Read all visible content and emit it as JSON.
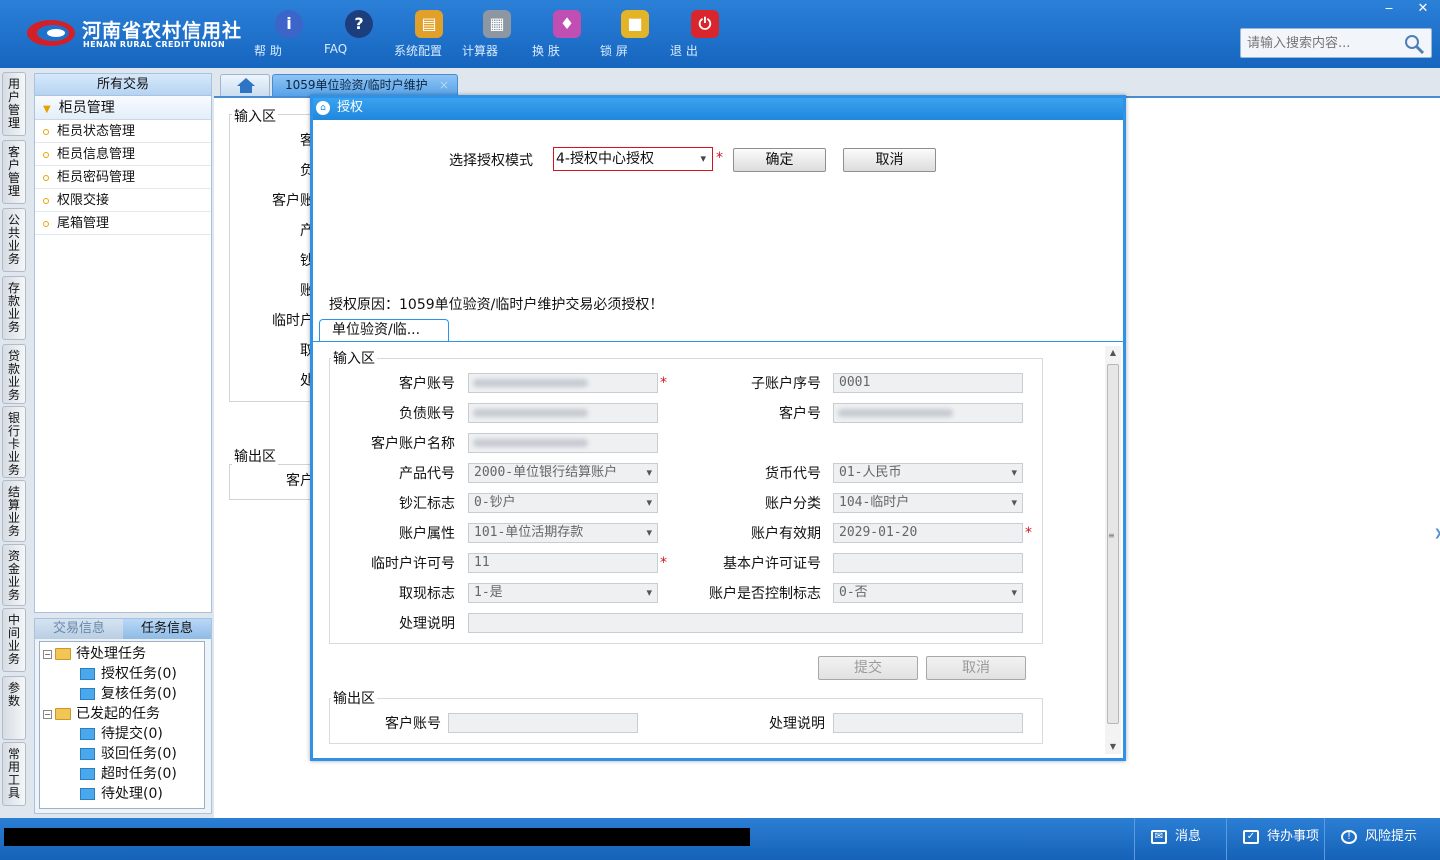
{
  "header": {
    "logo_cn": "河南省农村信用社",
    "logo_en": "HENAN RURAL CREDIT UNION",
    "tools": [
      {
        "label": "帮 助",
        "icon": "info-icon"
      },
      {
        "label": "FAQ",
        "icon": "question-icon"
      },
      {
        "label": "系统配置",
        "icon": "toolbox-icon"
      },
      {
        "label": "计算器",
        "icon": "calculator-icon"
      },
      {
        "label": "换 肤",
        "icon": "shirt-icon"
      },
      {
        "label": "锁 屏",
        "icon": "lock-icon"
      },
      {
        "label": "退 出",
        "icon": "power-icon"
      }
    ],
    "search_placeholder": "请输入搜索内容..."
  },
  "vtabs": [
    "用户管理",
    "客户管理",
    "公共业务",
    "存款业务",
    "贷款业务",
    "银行卡业务",
    "结算业务",
    "资金业务",
    "中间业务",
    "参数",
    "常用工具"
  ],
  "nav": {
    "head": "所有交易",
    "group": "柜员管理",
    "items": [
      "柜员状态管理",
      "柜员信息管理",
      "柜员密码管理",
      "权限交接",
      "尾箱管理"
    ]
  },
  "taskpanel": {
    "tabs": [
      "交易信息",
      "任务信息"
    ],
    "tree": {
      "pending": "待处理任务",
      "pending_children": [
        "授权任务(0)",
        "复核任务(0)"
      ],
      "initiated": "已发起的任务",
      "initiated_children": [
        "待提交(0)",
        "驳回任务(0)",
        "超时任务(0)",
        "待处理(0)"
      ]
    }
  },
  "maintab": {
    "title": "1059单位验资/临时户维护",
    "close": "×"
  },
  "background": {
    "input_legend": "输入区",
    "output_legend": "输出区",
    "labels": [
      "客",
      "负",
      "客户账",
      "产",
      "钞",
      "账",
      "临时户",
      "取",
      "处"
    ],
    "output_label": "客户"
  },
  "dialog": {
    "title": "授权",
    "mode_label": "选择授权模式",
    "mode_value": "4-授权中心授权",
    "confirm": "确定",
    "cancel": "取消",
    "reason": "授权原因：1059单位验资/临时户维护交易必须授权！",
    "subtab": "单位验资/临...",
    "input_legend": "输入区",
    "output_legend": "输出区",
    "fields": {
      "account_no": {
        "label": "客户账号",
        "value": ""
      },
      "sub_seq": {
        "label": "子账户序号",
        "value": "0001"
      },
      "debt_no": {
        "label": "负债账号",
        "value": ""
      },
      "cust_no": {
        "label": "客户号",
        "value": ""
      },
      "acct_name": {
        "label": "客户账户名称",
        "value": ""
      },
      "product": {
        "label": "产品代号",
        "value": "2000-单位银行结算账户"
      },
      "currency": {
        "label": "货币代号",
        "value": "01-人民币"
      },
      "cash_flag": {
        "label": "钞汇标志",
        "value": "0-钞户"
      },
      "acct_class": {
        "label": "账户分类",
        "value": "104-临时户"
      },
      "acct_attr": {
        "label": "账户属性",
        "value": "101-单位活期存款"
      },
      "validity": {
        "label": "账户有效期",
        "value": "2029-01-20"
      },
      "temp_permit": {
        "label": "临时户许可号",
        "value": "11"
      },
      "basic_permit": {
        "label": "基本户许可证号",
        "value": ""
      },
      "withdraw": {
        "label": "取现标志",
        "value": "1-是"
      },
      "controlled": {
        "label": "账户是否控制标志",
        "value": "0-否"
      },
      "remark": {
        "label": "处理说明",
        "value": ""
      }
    },
    "submit": "提交",
    "cancel2": "取消",
    "out_account": {
      "label": "客户账号",
      "value": ""
    },
    "out_remark": {
      "label": "处理说明",
      "value": ""
    }
  },
  "status": {
    "message": "消息",
    "todo": "待办事项",
    "risk": "风险提示"
  },
  "colors": {
    "header_blue": "#1f72cc",
    "dialog_border": "#2e93e8",
    "required": "#d1141c"
  }
}
